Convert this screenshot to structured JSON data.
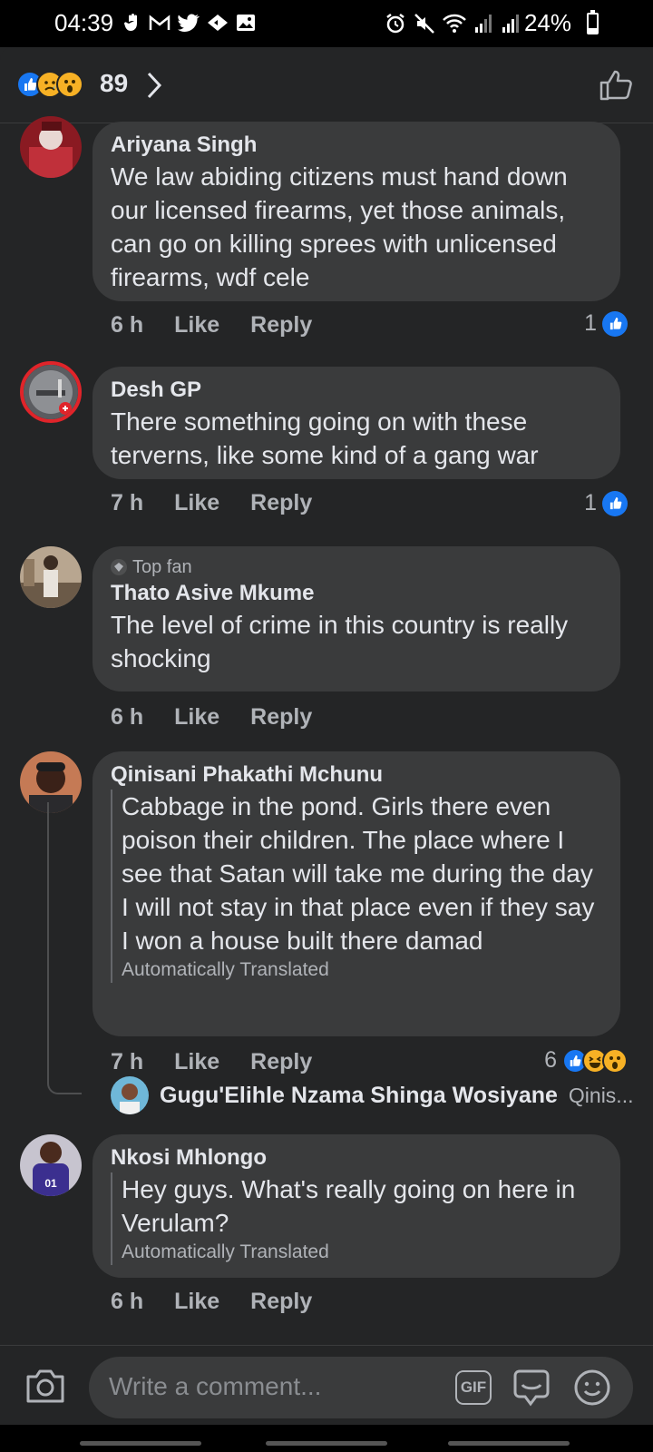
{
  "status_bar": {
    "time": "04:39",
    "battery": "24%",
    "battery_level": 0.24
  },
  "reactions_header": {
    "count": "89",
    "icons": [
      "like-icon",
      "sad-icon",
      "wow-icon"
    ]
  },
  "comments": [
    {
      "name": "Ariyana Singh",
      "text": "We law abiding citizens must hand down our licensed firearms, yet those animals, can go on killing sprees with unlicensed firearms, wdf cele",
      "time": "6 h",
      "like": "Like",
      "reply": "Reply",
      "reaction_count": "1"
    },
    {
      "name": "Desh GP",
      "text": "There something going on with these terverns, like some kind of a gang war",
      "time": "7 h",
      "like": "Like",
      "reply": "Reply",
      "reaction_count": "1"
    },
    {
      "badge": "Top fan",
      "name": "Thato Asive Mkume",
      "text": "The  level of crime in this country is really shocking",
      "time": "6 h",
      "like": "Like",
      "reply": "Reply"
    },
    {
      "name": "Qinisani Phakathi Mchunu",
      "text": "Cabbage in the pond. Girls there even poison their children. The place where I see that Satan will take me during the day I will not stay in that place even if they say I won a house built there damad",
      "translated_label": "Automatically Translated",
      "time": "7 h",
      "like": "Like",
      "reply": "Reply",
      "reaction_count": "6"
    },
    {
      "name": "Nkosi Mhlongo",
      "text": "Hey guys. What's really going on here in Verulam?",
      "translated_label": "Automatically Translated",
      "time": "6 h",
      "like": "Like",
      "reply": "Reply"
    }
  ],
  "reply_preview": {
    "name": "Gugu'Elihle Nzama Shinga Wosiyane",
    "text": "Qinis..."
  },
  "composer": {
    "placeholder": "Write a comment...",
    "gif_label": "GIF"
  },
  "colors": {
    "background": "#242526",
    "bubble": "#3a3b3c",
    "like_blue": "#1877f2",
    "reaction_yellow": "#f7b125"
  }
}
